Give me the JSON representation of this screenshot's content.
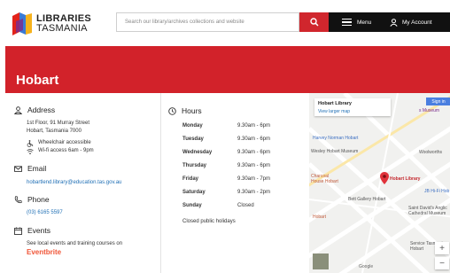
{
  "header": {
    "logo_line1": "LIBRARIES",
    "logo_line2": "TASMANIA",
    "search_placeholder": "Search our library/archives collections and website",
    "menu_label": "Menu",
    "account_label": "My Account"
  },
  "hero": {
    "title": "Hobart"
  },
  "address": {
    "heading": "Address",
    "line1": "1st Floor, 91 Murray Street",
    "line2": "Hobart, Tasmania 7000",
    "wheelchair": "Wheelchair accessible",
    "wifi": "Wi-fi access 6am - 9pm"
  },
  "email": {
    "heading": "Email",
    "value": "hobartlend.library@education.tas.gov.au"
  },
  "phone": {
    "heading": "Phone",
    "value": "(03) 6165 5597"
  },
  "events": {
    "heading": "Events",
    "text": "See local events and training courses on",
    "brand": "Eventbrite"
  },
  "hours": {
    "heading": "Hours",
    "rows": [
      {
        "day": "Monday",
        "time": "9.30am - 6pm"
      },
      {
        "day": "Tuesday",
        "time": "9.30am - 6pm"
      },
      {
        "day": "Wednesday",
        "time": "9.30am - 6pm"
      },
      {
        "day": "Thursday",
        "time": "9.30am - 6pm"
      },
      {
        "day": "Friday",
        "time": "9.30am - 7pm"
      },
      {
        "day": "Saturday",
        "time": "9.30am - 2pm"
      },
      {
        "day": "Sunday",
        "time": "Closed"
      }
    ],
    "note": "Closed public holidays"
  },
  "map": {
    "card_title": "Hobart Library",
    "card_link": "View larger map",
    "signin": "Sign in",
    "labels": {
      "museum": "s Museum",
      "harvey": "Harvey Norman Hobart",
      "wesley": "Wesley Hobart Museum",
      "woolworths": "Woolworths",
      "charcoal": "Charcoal\nHouse Hobart",
      "hobart_library": "Hobart Library",
      "bett": "Bett Gallery Hobart",
      "jb": "JB Hi-Fi Hob",
      "saint": "Saint David's Anglic\nCathedral Museum",
      "hobart_label": "Hobart",
      "service": "Service Tasmania\nHobart",
      "google": "Google"
    },
    "zoom_in": "+",
    "zoom_out": "−"
  },
  "colors": {
    "brand_red": "#d2222a",
    "dark": "#111111",
    "link": "#1f6fb5",
    "eventbrite": "#f05537"
  }
}
